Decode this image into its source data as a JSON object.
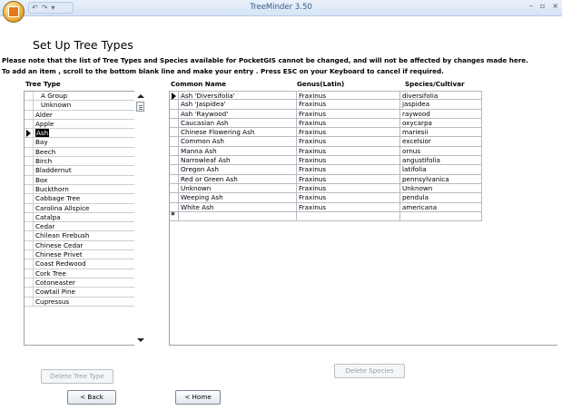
{
  "window": {
    "title": "TreeMinder 3.50",
    "controls": [
      "–",
      "▫",
      "×"
    ]
  },
  "quick_access": [
    "↶",
    "↷",
    "▾"
  ],
  "page": {
    "heading": "Set Up Tree Types",
    "note1": "Please note that the list of Tree Types and Species available for PocketGIS cannot be changed, and will not be affected by changes made here.",
    "note2": "To add an item , scroll to the bottom blank line and make your entry . Press ESC on your Keyboard to cancel if required."
  },
  "tree_types": {
    "header": "Tree Type",
    "items": [
      "A Group",
      "Unknown",
      "Alder",
      "Apple",
      "Ash",
      "Bay",
      "Beech",
      "Birch",
      "Bladdernut",
      "Box",
      "Buckthorn",
      "Cabbage Tree",
      "Carolina Allspice",
      "Catalpa",
      "Cedar",
      "Chilean Firebush",
      "Chinese Cedar",
      "Chinese Privet",
      "Coast Redwood",
      "Cork Tree",
      "Cotoneaster",
      "Cowtail Pine",
      "Cupressus"
    ],
    "selected_index": 4
  },
  "species": {
    "headers": [
      "Common Name",
      "Genus(Latin)",
      "Species/Cultivar"
    ],
    "rows": [
      [
        "Ash 'Diversifolia'",
        "Fraxinus",
        "diversifolia"
      ],
      [
        "Ash 'Jaspidea'",
        "Fraxinus",
        "jaspidea"
      ],
      [
        "Ash 'Raywood'",
        "Fraxinus",
        "raywood"
      ],
      [
        "Caucasian Ash",
        "Fraxinus",
        "oxycarpa"
      ],
      [
        "Chinese Flowering Ash",
        "Fraxinus",
        "mariesii"
      ],
      [
        "Common Ash",
        "Fraxinus",
        "excelsior"
      ],
      [
        "Manna Ash",
        "Fraxinus",
        "ornus"
      ],
      [
        "Narrowleaf Ash",
        "Fraxinus",
        "angustifolia"
      ],
      [
        "Oregon Ash",
        "Fraxinus",
        "latifolia"
      ],
      [
        "Red or Green Ash",
        "Fraxinus",
        "pennsylvanica"
      ],
      [
        "Unknown",
        "Fraxinus",
        "Unknown"
      ],
      [
        "Weeping Ash",
        "Fraxinus",
        "pendula"
      ],
      [
        "White Ash",
        "Fraxinus",
        "americana"
      ]
    ],
    "new_row_marker": "*"
  },
  "buttons": {
    "delete_tree_type": "Delete Tree Type",
    "delete_species": "Delete Species",
    "back": "< Back",
    "home": "< Home"
  }
}
